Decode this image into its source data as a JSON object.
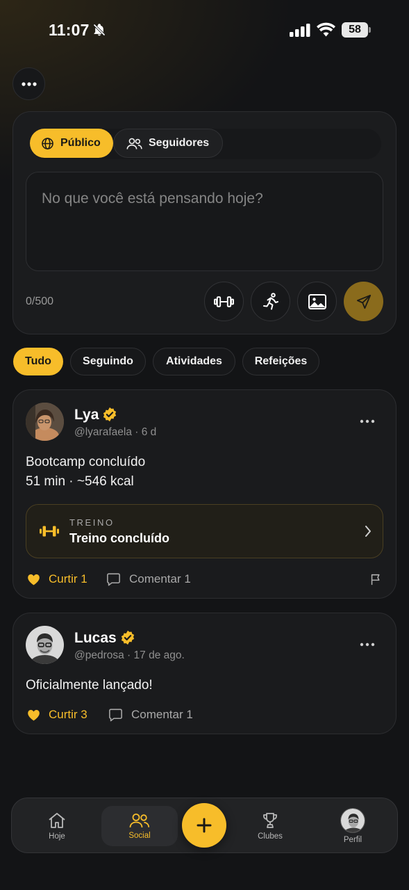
{
  "status_bar": {
    "time": "11:07",
    "battery": "58"
  },
  "composer": {
    "visibility": [
      {
        "label": "Público",
        "icon": "globe-icon",
        "selected": true
      },
      {
        "label": "Seguidores",
        "icon": "users-icon",
        "selected": false
      }
    ],
    "placeholder": "No que você está pensando hoje?",
    "char_counter": "0/500",
    "tools": [
      "dumbbell-icon",
      "running-icon",
      "image-icon"
    ],
    "send_icon": "send-icon"
  },
  "filters": [
    {
      "label": "Tudo",
      "active": true
    },
    {
      "label": "Seguindo",
      "active": false
    },
    {
      "label": "Atividades",
      "active": false
    },
    {
      "label": "Refeições",
      "active": false
    }
  ],
  "posts": [
    {
      "name": "Lya",
      "meta": "@lyarafaela · 6 d",
      "lines": [
        "Bootcamp concluído",
        "51 min · ~546 kcal"
      ],
      "attachment": {
        "kicker": "TREINO",
        "title": "Treino concluído"
      },
      "like_label": "Curtir 1",
      "comment_label": "Comentar 1"
    },
    {
      "name": "Lucas",
      "meta": "@pedrosa · 17 de ago.",
      "lines": [
        "Oficialmente lançado!"
      ],
      "like_label": "Curtir 3",
      "comment_label": "Comentar 1"
    }
  ],
  "nav": {
    "items": [
      {
        "label": "Hoje",
        "icon": "home-icon"
      },
      {
        "label": "Social",
        "icon": "users-icon",
        "active": true
      },
      {
        "label": "Clubes",
        "icon": "trophy-icon"
      },
      {
        "label": "Perfil",
        "icon": "avatar"
      }
    ]
  },
  "colors": {
    "accent": "#f7bd2a",
    "background": "#131416",
    "card": "#1a1b1d"
  }
}
